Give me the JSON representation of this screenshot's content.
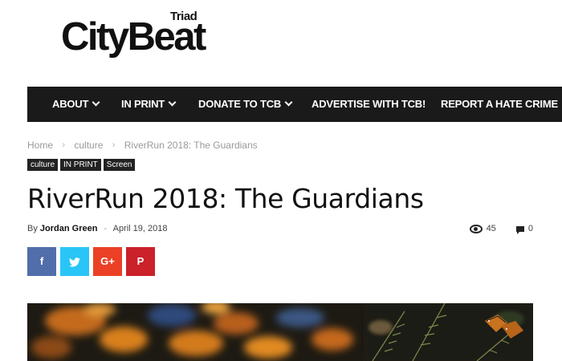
{
  "logo": {
    "small": "Triad",
    "main": "CityBeat"
  },
  "nav": {
    "items": [
      {
        "label": "ABOUT",
        "dropdown": true
      },
      {
        "label": "IN PRINT",
        "dropdown": true
      },
      {
        "label": "DONATE TO TCB",
        "dropdown": true
      },
      {
        "label": "ADVERTISE WITH TCB!",
        "dropdown": false
      },
      {
        "label": "REPORT A HATE CRIME",
        "dropdown": false
      }
    ]
  },
  "breadcrumb": {
    "items": [
      "Home",
      "culture",
      "RiverRun 2018: The Guardians"
    ],
    "separator": "›"
  },
  "tags": [
    "culture",
    "IN PRINT",
    "Screen"
  ],
  "article": {
    "title": "RiverRun 2018: The Guardians",
    "by_label": "By",
    "author": "Jordan Green",
    "date_separator": "-",
    "date": "April 19, 2018",
    "views": "45",
    "comments": "0"
  },
  "share": [
    {
      "network": "facebook",
      "glyph": "f",
      "color": "#516eab"
    },
    {
      "network": "twitter",
      "glyph": "🐦",
      "color": "#29c5f6"
    },
    {
      "network": "google-plus",
      "glyph": "G+",
      "color": "#eb4026"
    },
    {
      "network": "pinterest",
      "glyph": "P",
      "color": "#ca212a"
    }
  ],
  "hero_image": {
    "subject": "monarch-butterflies-in-tree"
  },
  "colors": {
    "navbar": "#1a1a1a",
    "tag_bg": "#222222",
    "meta_muted": "#999999"
  }
}
